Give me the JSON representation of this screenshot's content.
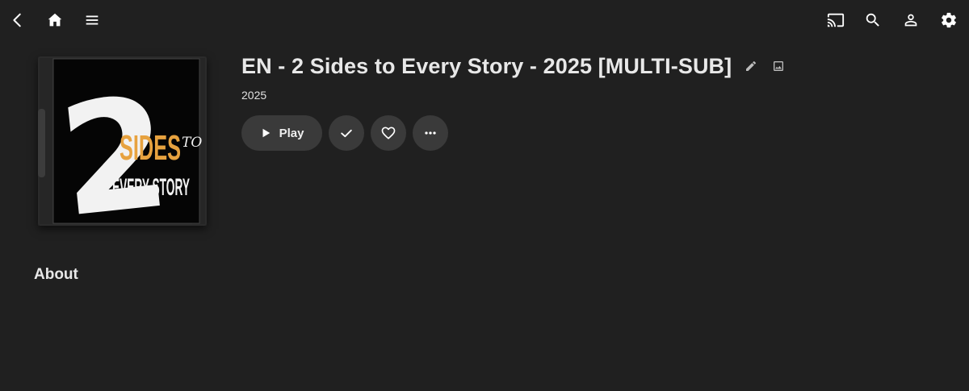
{
  "topbar": {
    "icons": [
      "back-arrow-icon",
      "home-icon",
      "menu-icon",
      "cast-icon",
      "search-icon",
      "user-icon",
      "settings-gear-icon"
    ]
  },
  "item": {
    "title": "EN - 2 Sides to Every Story - 2025 [MULTI-SUB]",
    "year": "2025",
    "poster": {
      "line1_number": "2",
      "line1_word": "SIDES",
      "line1_suffix": "TO",
      "line2": "EVERY STORY",
      "accent_color": "#e7a23f"
    }
  },
  "actions": {
    "play_label": "Play"
  },
  "sections": {
    "about_label": "About"
  },
  "colors": {
    "background": "#202020",
    "button_bg": "#3a3a3a",
    "text": "#e6e6e6"
  }
}
